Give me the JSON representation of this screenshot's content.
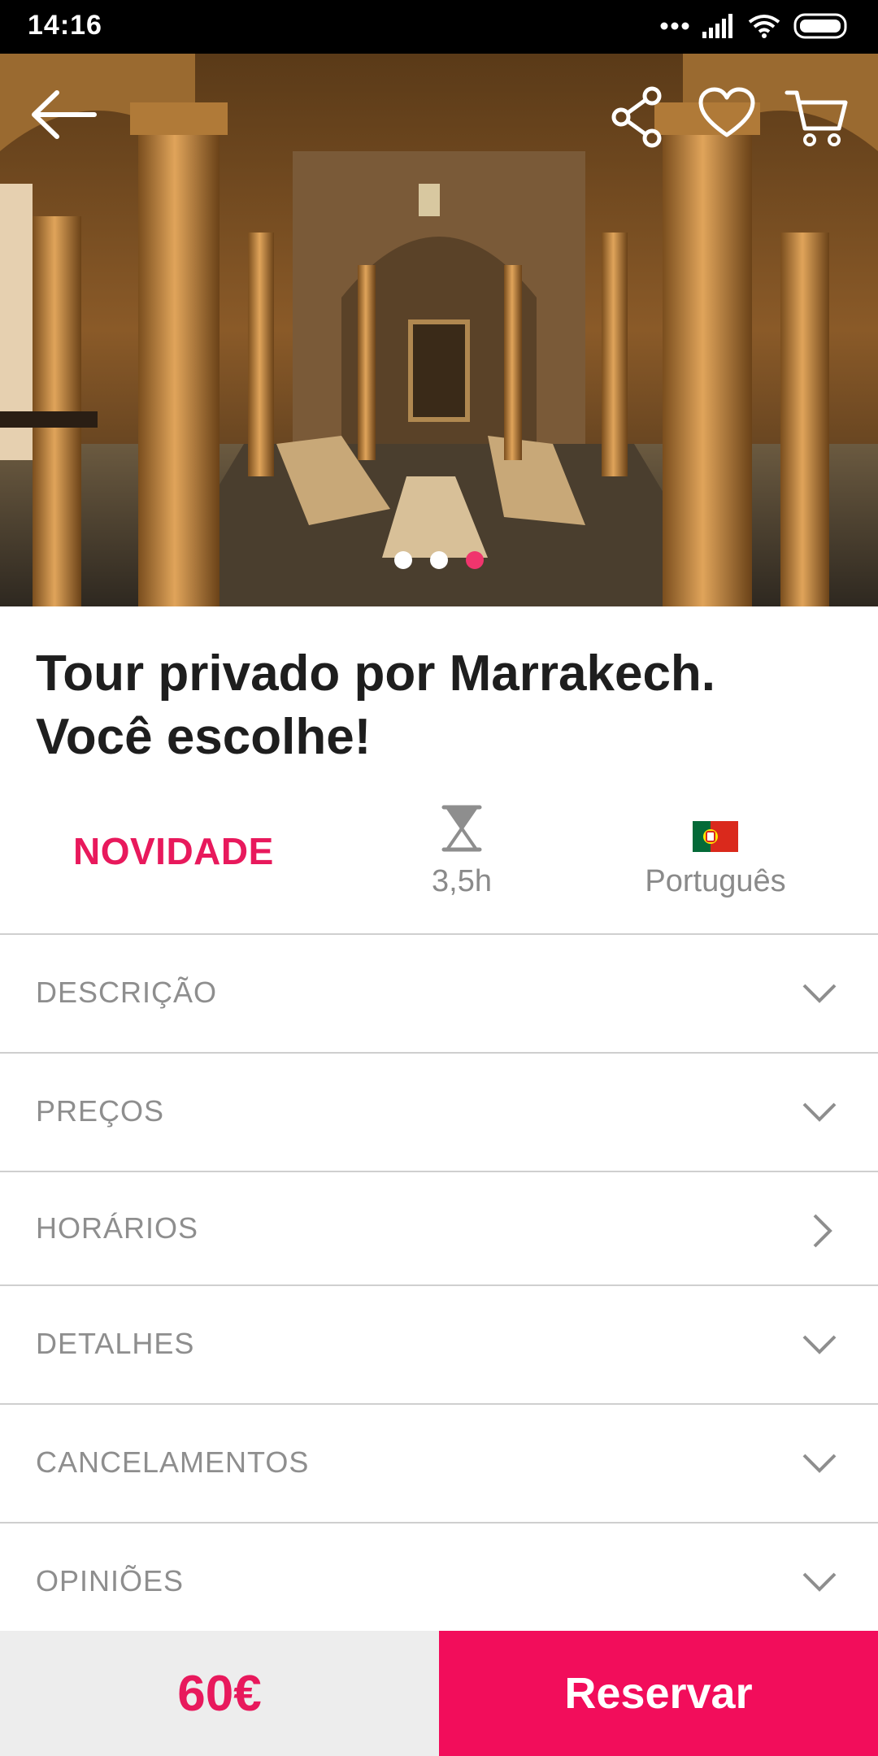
{
  "status_bar": {
    "time": "14:16"
  },
  "hero": {
    "carousel_pages": 3,
    "active_page": 3
  },
  "tour": {
    "title_line1": "Tour privado por Marrakech.",
    "title_line2": "Você escolhe!"
  },
  "info": {
    "badge": "NOVIDADE",
    "duration": "3,5h",
    "language": "Português"
  },
  "sections": [
    {
      "label": "DESCRIÇÃO",
      "icon": "chevron-down-icon"
    },
    {
      "label": "PREÇOS",
      "icon": "chevron-down-icon"
    },
    {
      "label": "HORÁRIOS",
      "icon": "chevron-right-icon"
    },
    {
      "label": "DETALHES",
      "icon": "chevron-down-icon"
    },
    {
      "label": "CANCELAMENTOS",
      "icon": "chevron-down-icon"
    },
    {
      "label": "OPINIÕES",
      "icon": "chevron-down-icon"
    }
  ],
  "footer": {
    "price": "60€",
    "reserve_label": "Reservar"
  },
  "colors": {
    "accent": "#e8195c",
    "reserve_bg": "#f20d5b",
    "price_bg": "#ededed"
  }
}
